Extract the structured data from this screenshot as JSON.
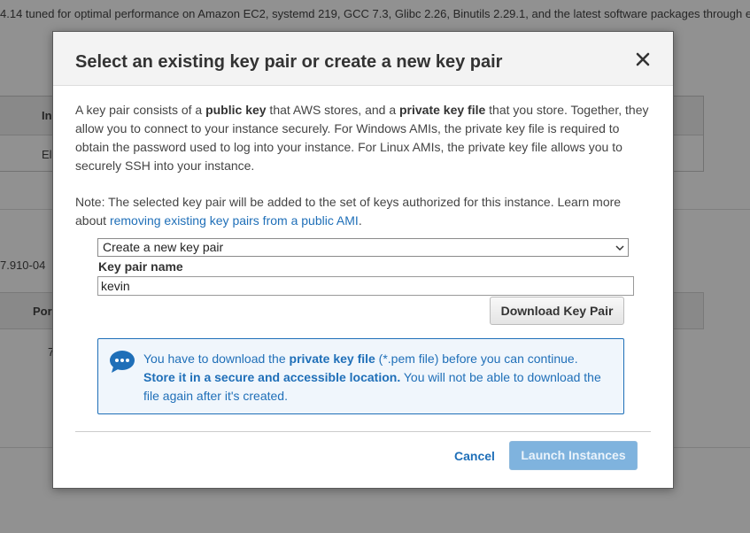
{
  "background": {
    "top_text": "4.14 tuned for optimal performance on Amazon EC2, systemd 219, GCC 7.3, Glibc 2.26, Binutils 2.29.1, and the latest software packages through e",
    "table_header_fragment": "In",
    "table_cell_fragment": "El",
    "left_text_fragment": "7.910-04",
    "table2_header_fragment": "Por",
    "table2_cell_fragment": "7"
  },
  "modal": {
    "title": "Select an existing key pair or create a new key pair",
    "close_icon": "close-icon",
    "intro": {
      "t1": "A key pair consists of a ",
      "b1": "public key",
      "t2": " that AWS stores, and a ",
      "b2": "private key file",
      "t3": " that you store. Together, they allow you to connect to your instance securely. For Windows AMIs, the private key file is required to obtain the password used to log into your instance. For Linux AMIs, the private key file allows you to securely SSH into your instance."
    },
    "note": {
      "text": "Note: The selected key pair will be added to the set of keys authorized for this instance. Learn more about ",
      "link": "removing existing key pairs from a public AMI",
      "end": "."
    },
    "select": {
      "value": "Create a new key pair",
      "icon": "chevron-down-icon"
    },
    "key_pair_name": {
      "label": "Key pair name",
      "value": "kevin"
    },
    "download_button": "Download Key Pair",
    "info": {
      "icon": "chat-bubble-icon",
      "t1": "You have to download the ",
      "b1": "private key file",
      "t2": " (*.pem file) before you can continue.",
      "b2": "Store it in a secure and accessible location.",
      "t3": " You will not be able to download the file again after it's created."
    },
    "cancel": "Cancel",
    "launch": "Launch Instances"
  },
  "colors": {
    "link": "#1f6fb8",
    "info_bg": "#f0f6fc",
    "launch_bg": "#7fb3de",
    "overlay": "rgba(0,0,0,0.43)"
  }
}
